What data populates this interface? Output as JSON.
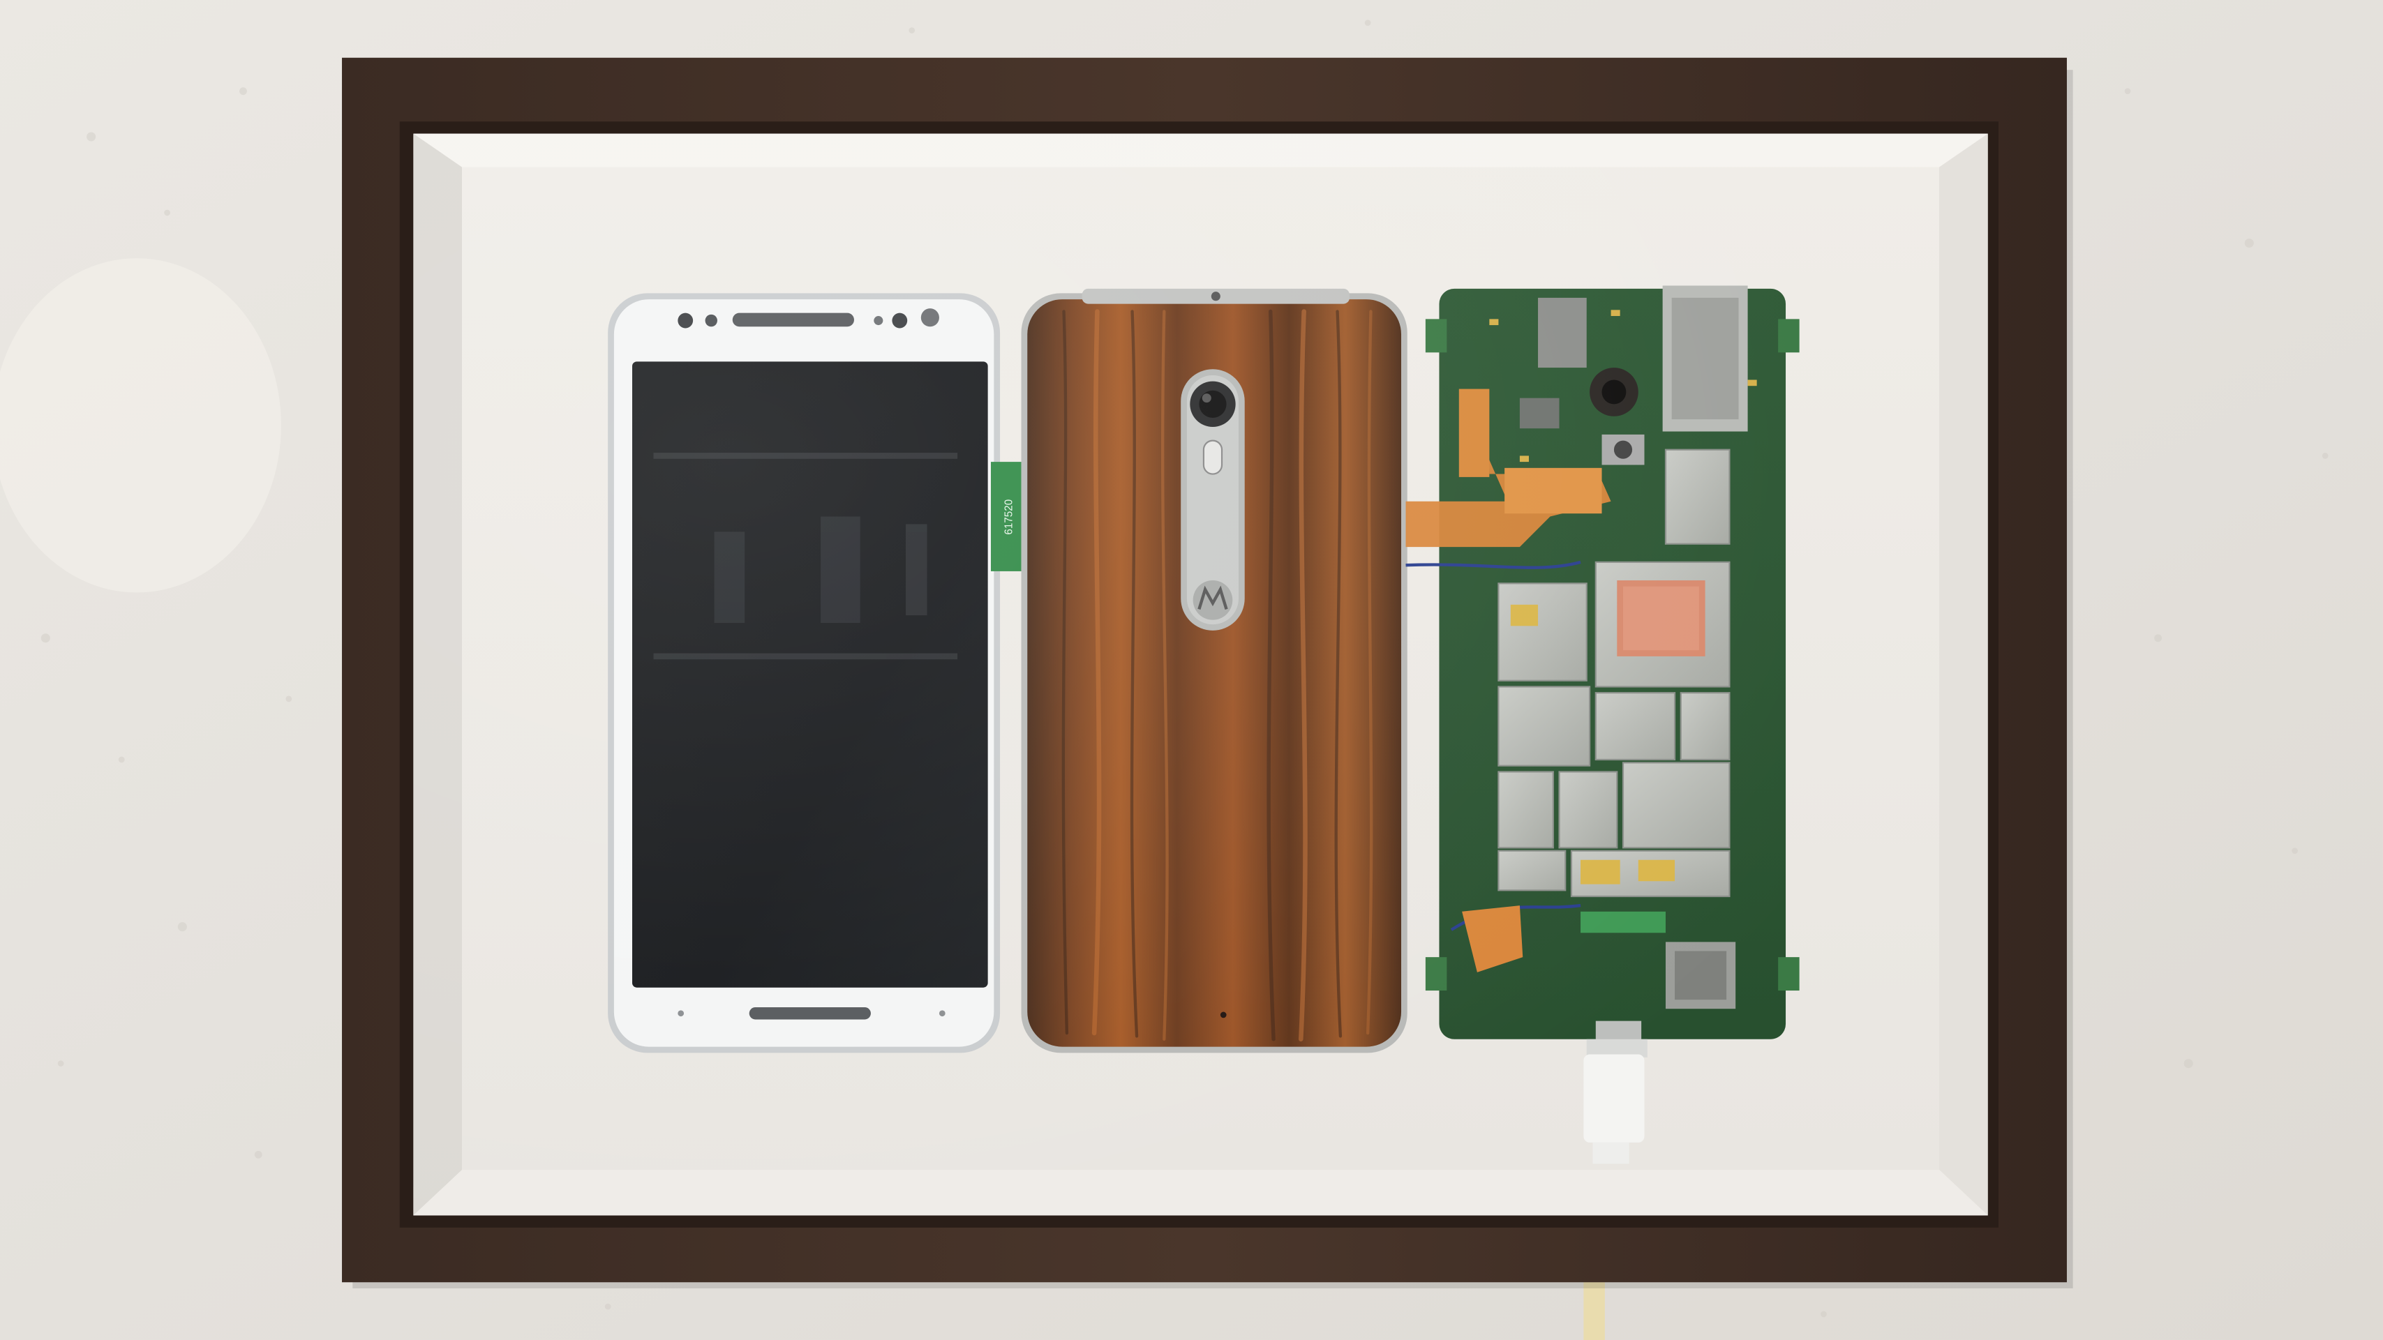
{
  "scene": {
    "description_items": [
      "wall",
      "shadow-box-frame",
      "phone-front",
      "phone-back",
      "phone-motherboard",
      "usb-cable"
    ],
    "frame_color": "#3a2a22",
    "wall_color": "#e6e3de",
    "mat_color": "#efece7",
    "wood_color": "#8a4a22"
  },
  "labels": {
    "flex_tag": "617520"
  }
}
